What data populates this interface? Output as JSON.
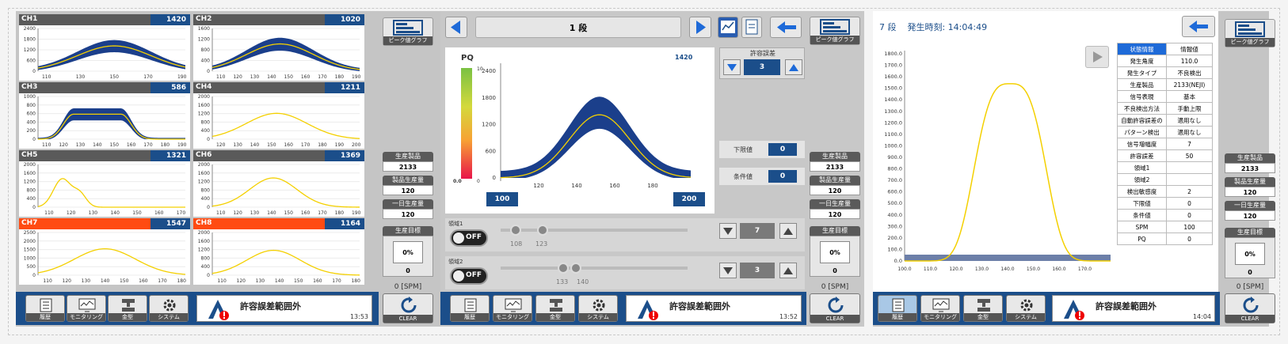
{
  "colors": {
    "nav_blue": "#1b4e8a",
    "alarm_red": "#ff4b12",
    "curve_yellow": "#f4d000",
    "band_blue": "#1b3f8b"
  },
  "panel1": {
    "charts": [
      {
        "label": "CH1",
        "value": "1420",
        "alert": false,
        "kind": "band",
        "yticks": [
          "2400",
          "1800",
          "1200",
          "600",
          "0"
        ],
        "xticks": [
          "110",
          "130",
          "150",
          "170",
          "190"
        ],
        "ymax": 2400,
        "peak": 1420,
        "center": 150,
        "width": 22
      },
      {
        "label": "CH2",
        "value": "1020",
        "alert": false,
        "kind": "band",
        "yticks": [
          "1600",
          "1200",
          "800",
          "400",
          "0"
        ],
        "xticks": [
          "110",
          "120",
          "130",
          "140",
          "150",
          "160",
          "170",
          "180",
          "190"
        ],
        "ymax": 1600,
        "peak": 1020,
        "center": 145,
        "width": 20
      },
      {
        "label": "CH3",
        "value": "586",
        "alert": false,
        "kind": "band-flat",
        "yticks": [
          "1000",
          "800",
          "600",
          "400",
          "200",
          "0"
        ],
        "xticks": [
          "110",
          "120",
          "130",
          "140",
          "150",
          "160",
          "170",
          "180",
          "190"
        ],
        "ymax": 1000,
        "peak": 586,
        "center": 140,
        "width": 14
      },
      {
        "label": "CH4",
        "value": "1211",
        "alert": false,
        "kind": "line",
        "yticks": [
          "2000",
          "1600",
          "1200",
          "800",
          "400",
          "0"
        ],
        "xticks": [
          "120",
          "130",
          "140",
          "150",
          "160",
          "170",
          "180",
          "190",
          "200"
        ],
        "ymax": 2000,
        "peak": 1211,
        "center": 153,
        "width": 18
      },
      {
        "label": "CH5",
        "value": "1321",
        "alert": false,
        "kind": "double",
        "yticks": [
          "2000",
          "1600",
          "1200",
          "800",
          "400",
          "0"
        ],
        "xticks": [
          "110",
          "120",
          "130",
          "140",
          "150",
          "160",
          "170"
        ],
        "ymax": 2000,
        "peak": 1321,
        "center": 116,
        "width": 4
      },
      {
        "label": "CH6",
        "value": "1369",
        "alert": false,
        "kind": "line",
        "yticks": [
          "2000",
          "1600",
          "1200",
          "800",
          "400",
          "0"
        ],
        "xticks": [
          "110",
          "120",
          "130",
          "140",
          "150",
          "160",
          "170",
          "180",
          "190"
        ],
        "ymax": 2000,
        "peak": 1369,
        "center": 141,
        "width": 14
      },
      {
        "label": "CH7",
        "value": "1547",
        "alert": true,
        "kind": "line",
        "yticks": [
          "2500",
          "2000",
          "1500",
          "1000",
          "500",
          "0"
        ],
        "xticks": [
          "110",
          "120",
          "130",
          "140",
          "150",
          "160",
          "170",
          "180"
        ],
        "ymax": 2500,
        "peak": 1547,
        "center": 140,
        "width": 16
      },
      {
        "label": "CH8",
        "value": "1164",
        "alert": true,
        "kind": "line",
        "yticks": [
          "2000",
          "1600",
          "1200",
          "800",
          "400",
          "0"
        ],
        "xticks": [
          "110",
          "120",
          "130",
          "140",
          "150",
          "160",
          "170",
          "180"
        ],
        "ymax": 2000,
        "peak": 1164,
        "center": 137,
        "width": 14
      }
    ],
    "peak_graph_label": "ピーク値グラフ",
    "stats": [
      {
        "title": "生産製品",
        "value": "2133"
      },
      {
        "title": "製品生産量",
        "value": "120"
      },
      {
        "title": "一日生産量",
        "value": "120"
      }
    ],
    "goal": {
      "title": "生産目標",
      "pct": "0%",
      "count": "0"
    },
    "spm": "0 [SPM]",
    "nav": [
      "履歴",
      "モニタリング",
      "金型",
      "システム"
    ],
    "alarm": {
      "message": "許容誤差範囲外",
      "time": "13:53"
    },
    "clear": "CLEAR"
  },
  "panel2": {
    "stage": "1 段",
    "pq_label": "PQ",
    "pq_scale_top": "10",
    "pq_scale_bottom": "0.0",
    "pq_scale_zero": "0",
    "chart_peak": "1420",
    "chart_yticks": [
      "2400",
      "1800",
      "1200",
      "600",
      "0"
    ],
    "chart_xticks": [
      "120",
      "140",
      "160",
      "180"
    ],
    "range_left": "100",
    "range_right": "200",
    "tolerance": {
      "title": "許容誤差",
      "value": "3"
    },
    "lower_limit": {
      "title": "下限値",
      "value": "0"
    },
    "condition": {
      "title": "条件値",
      "value": "0"
    },
    "region1": {
      "title": "領域1",
      "toggle": "OFF",
      "from": "108",
      "to": "123",
      "step": "7"
    },
    "region2": {
      "title": "領域2",
      "toggle": "OFF",
      "from": "133",
      "to": "140",
      "step": "3"
    },
    "peak_graph_label": "ピーク値グラフ",
    "stats": [
      {
        "title": "生産製品",
        "value": "2133"
      },
      {
        "title": "製品生産量",
        "value": "120"
      },
      {
        "title": "一日生産量",
        "value": "120"
      }
    ],
    "goal": {
      "title": "生産目標",
      "pct": "0%",
      "count": "0"
    },
    "spm": "0 [SPM]",
    "nav": [
      "履歴",
      "モニタリング",
      "金型",
      "システム"
    ],
    "alarm": {
      "message": "許容誤差範囲外",
      "time": "13:52"
    },
    "clear": "CLEAR"
  },
  "panel3": {
    "header": "7 段    発生時刻: 14:04:49",
    "chart_yticks": [
      "1800.0",
      "1700.0",
      "1600.0",
      "1500.0",
      "1400.0",
      "1300.0",
      "1200.0",
      "1100.0",
      "1000.0",
      "900.0",
      "800.0",
      "700.0",
      "600.0",
      "500.0",
      "400.0",
      "300.0",
      "200.0",
      "100.0",
      "0.0"
    ],
    "chart_xticks": [
      "100.0",
      "110.0",
      "120.0",
      "130.0",
      "140.0",
      "150.0",
      "160.0",
      "170.0"
    ],
    "info_header": {
      "key": "状態情報",
      "value": "情報値"
    },
    "info": [
      {
        "k": "発生角度",
        "v": "110.0"
      },
      {
        "k": "発生タイプ",
        "v": "不良検出"
      },
      {
        "k": "生産製品",
        "v": "2133(NEJI)"
      },
      {
        "k": "信号表現",
        "v": "基本"
      },
      {
        "k": "不良検出方法",
        "v": "手動上限"
      },
      {
        "k": "自動許容誤差の",
        "v": "適用なし"
      },
      {
        "k": "パターン検出",
        "v": "適用なし"
      },
      {
        "k": "信号増幅度",
        "v": "7"
      },
      {
        "k": "許容誤差",
        "v": "50"
      },
      {
        "k": "領域1",
        "v": ""
      },
      {
        "k": "領域2",
        "v": ""
      },
      {
        "k": "検出敏感度",
        "v": "2"
      },
      {
        "k": "下限値",
        "v": "0"
      },
      {
        "k": "条件値",
        "v": "0"
      },
      {
        "k": "SPM",
        "v": "100"
      },
      {
        "k": "PQ",
        "v": "0"
      }
    ],
    "peak_graph_label": "ピーク値グラフ",
    "stats": [
      {
        "title": "生産製品",
        "value": "2133"
      },
      {
        "title": "製品生産量",
        "value": "120"
      },
      {
        "title": "一日生産量",
        "value": "120"
      }
    ],
    "goal": {
      "title": "生産目標",
      "pct": "0%",
      "count": "0"
    },
    "spm": "0 [SPM]",
    "nav": [
      "履歴",
      "モニタリング",
      "金型",
      "システム"
    ],
    "alarm": {
      "message": "許容誤差範囲外",
      "time": "14:04"
    },
    "clear": "CLEAR"
  }
}
